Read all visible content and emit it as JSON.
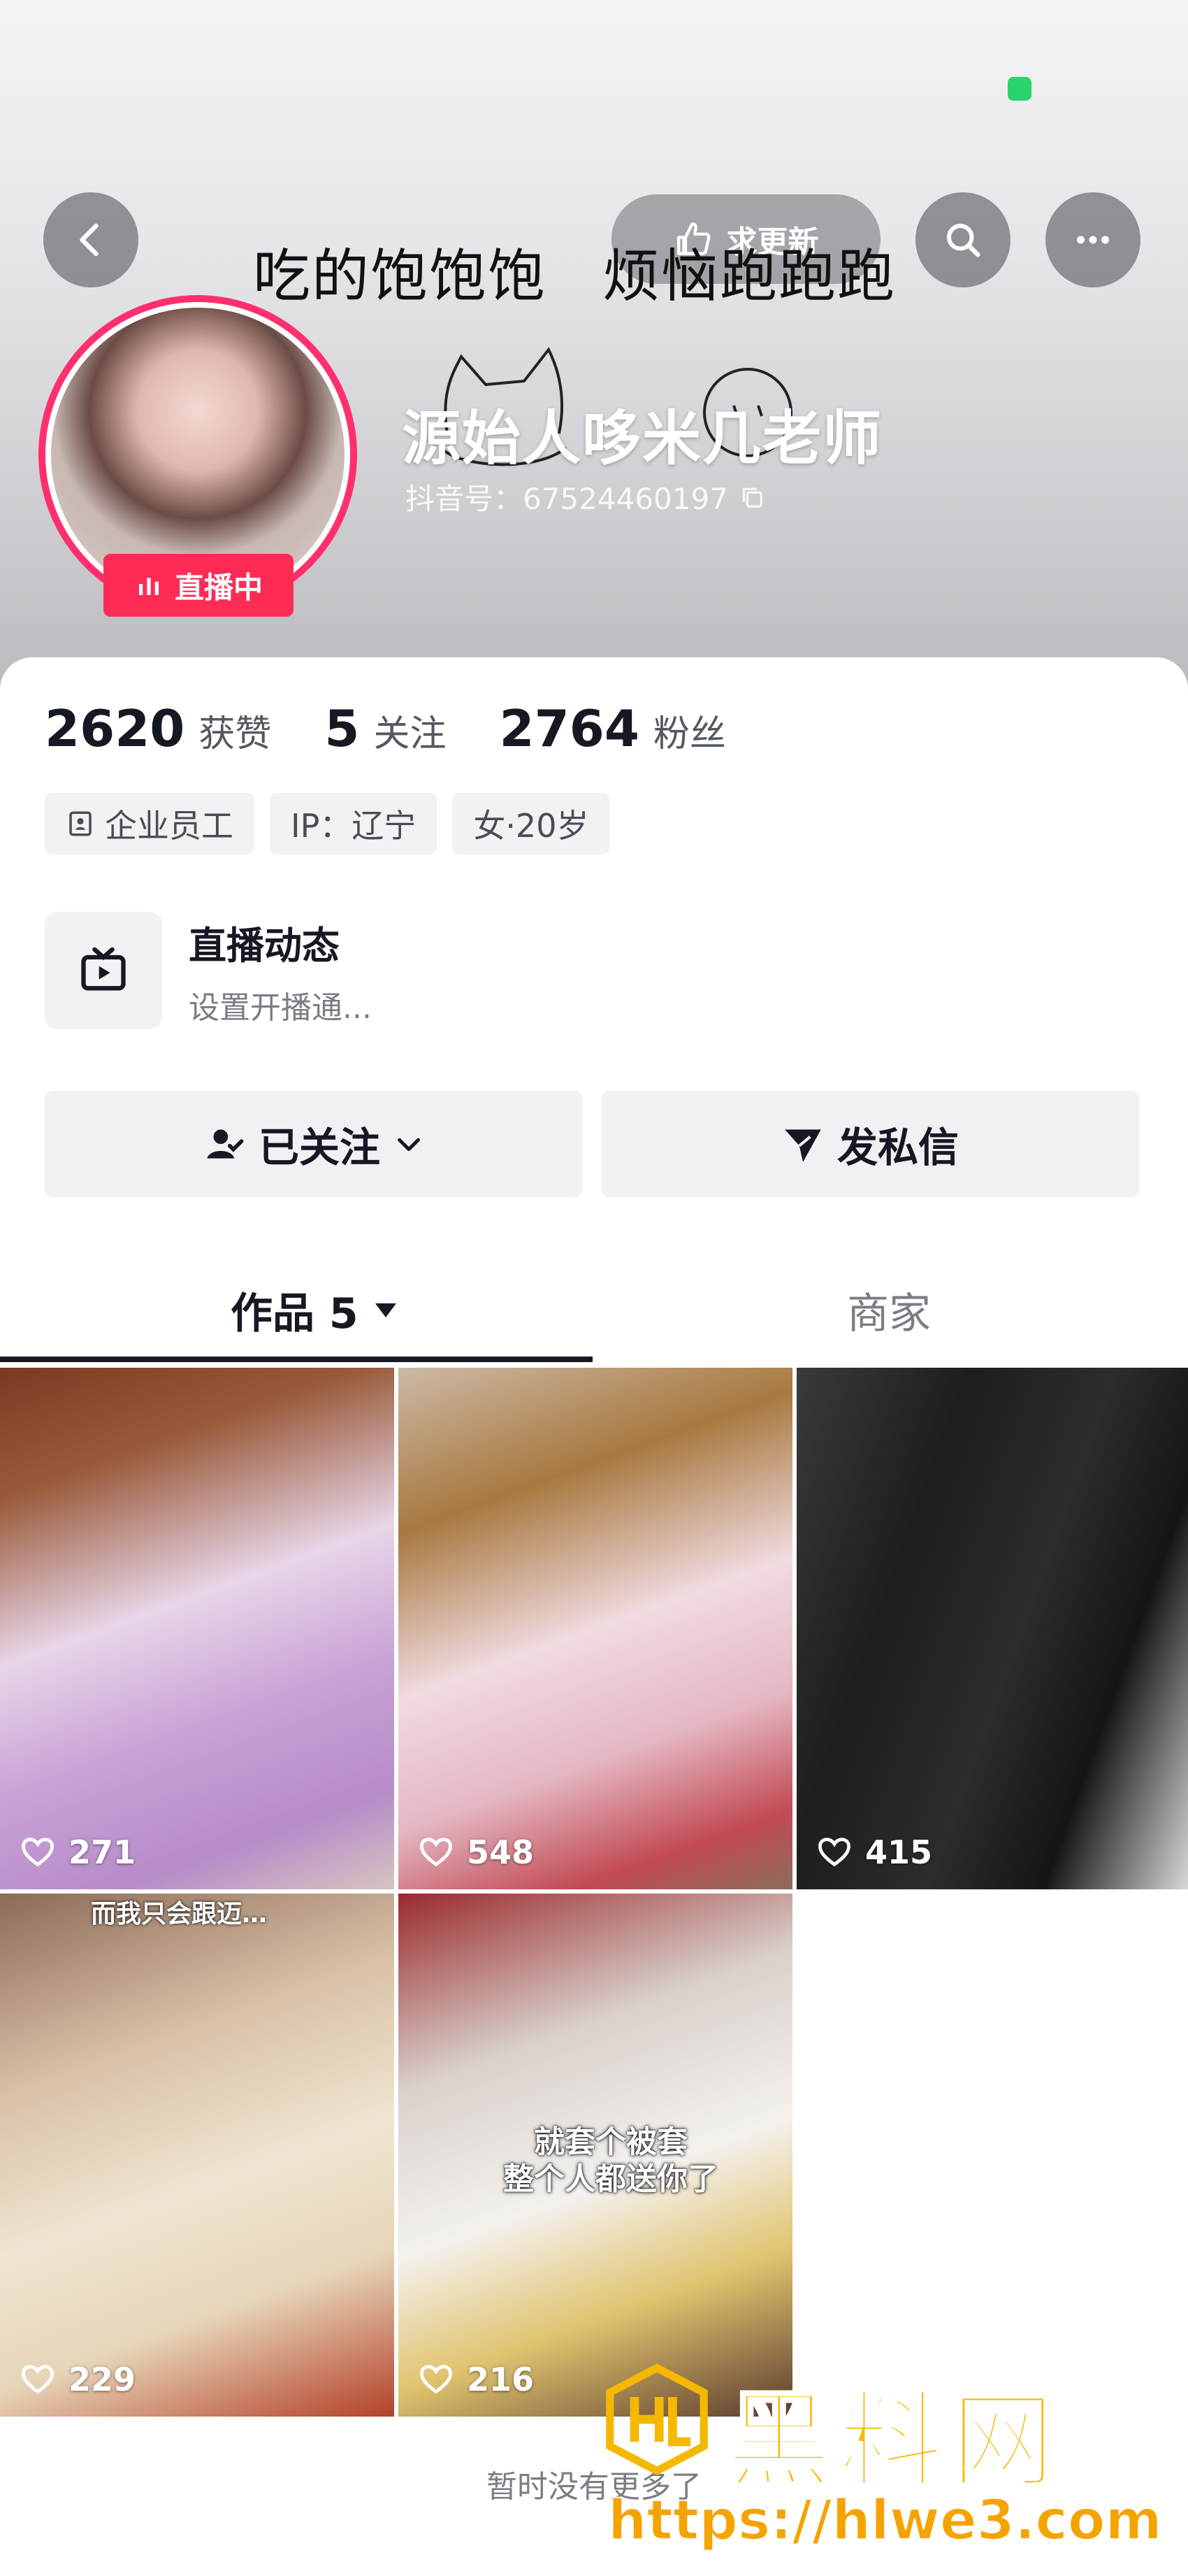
{
  "header": {
    "request_update_label": "求更新",
    "scribble_left": "吃的饱饱饱",
    "scribble_right": "烦恼跑跑跑",
    "live_badge": "直播中",
    "nickname": "源始人哆米几老师",
    "douyin_id": "抖音号：67524460197"
  },
  "stats": [
    {
      "value": "2620",
      "label": "获赞"
    },
    {
      "value": "5",
      "label": "关注"
    },
    {
      "value": "2764",
      "label": "粉丝"
    }
  ],
  "tags": {
    "job": "企业员工",
    "ip": "IP：辽宁",
    "gender_age": "女·20岁"
  },
  "live_dynamic": {
    "title": "直播动态",
    "subtitle": "设置开播通..."
  },
  "actions": {
    "follow_label": "已关注",
    "message_label": "发私信"
  },
  "tabs": {
    "works_label": "作品 5",
    "shop_label": "商家"
  },
  "videos": [
    {
      "likes": "271"
    },
    {
      "likes": "548"
    },
    {
      "likes": "415"
    },
    {
      "likes": "229",
      "caption": "而我只会跟迈…"
    },
    {
      "likes": "216",
      "caption_line1": "就套个被套",
      "caption_line2": "整个人都送你了"
    }
  ],
  "footer": {
    "no_more": "暂时没有更多了"
  },
  "watermark": {
    "brand": "黑料网",
    "url": "https://hlwe3.com"
  },
  "colors": {
    "accent": "#fe2c55",
    "watermark": "#f5b800"
  }
}
